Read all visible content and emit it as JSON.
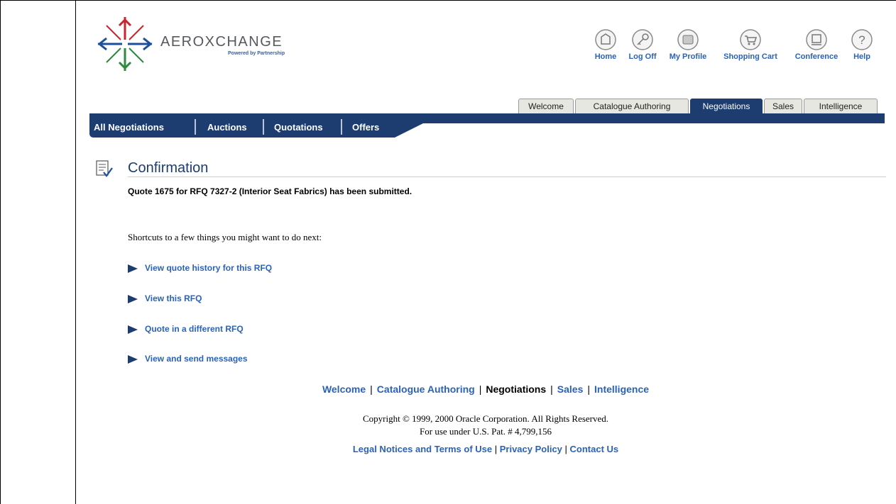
{
  "logo": {
    "name": "AEROXCHANGE",
    "tagline": "Powered by Partnership"
  },
  "global_nav": [
    {
      "label": "Home",
      "icon": "home-icon"
    },
    {
      "label": "Log Off",
      "icon": "key-icon"
    },
    {
      "label": "My Profile",
      "icon": "profile-icon"
    },
    {
      "label": "Shopping Cart",
      "icon": "cart-icon"
    },
    {
      "label": "Conference",
      "icon": "conference-icon"
    },
    {
      "label": "Help",
      "icon": "help-icon"
    }
  ],
  "tabs": [
    {
      "label": "Welcome",
      "active": false
    },
    {
      "label": "Catalogue Authoring",
      "active": false
    },
    {
      "label": "Negotiations",
      "active": true
    },
    {
      "label": "Sales",
      "active": false
    },
    {
      "label": "Intelligence",
      "active": false
    }
  ],
  "subnav": [
    {
      "label": "All Negotiations"
    },
    {
      "label": "Auctions"
    },
    {
      "label": "Quotations"
    },
    {
      "label": "Offers"
    }
  ],
  "page": {
    "title": "Confirmation",
    "message": "Quote 1675 for RFQ 7327-2 (Interior Seat Fabrics) has been submitted.",
    "shortcuts_intro": "Shortcuts to a few things you might want to do next:",
    "shortcuts": [
      "View quote history for this RFQ",
      "View this RFQ",
      "Quote in a different RFQ",
      "View and send messages"
    ]
  },
  "footer": {
    "links": [
      "Welcome",
      "Catalogue Authoring",
      "Negotiations",
      "Sales",
      "Intelligence"
    ],
    "current": "Negotiations",
    "copyright_line1": "Copyright © 1999, 2000 Oracle Corporation. All Rights Reserved.",
    "copyright_line2": "For use under U.S. Pat. # 4,799,156",
    "legal_links": [
      "Legal Notices and Terms of Use",
      "Privacy Policy",
      "Contact Us"
    ]
  },
  "colors": {
    "navy": "#1d3c6f",
    "link_blue": "#2a62b8",
    "tab_inactive": "#e7e7e2"
  }
}
